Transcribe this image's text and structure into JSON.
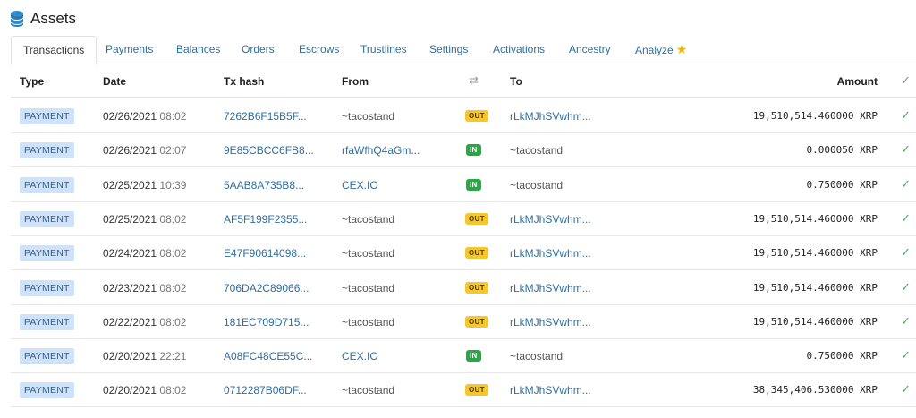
{
  "header": {
    "title": "Assets",
    "logo_icon": "coin-stack-icon"
  },
  "tabs": [
    {
      "label": "Transactions",
      "active": true
    },
    {
      "label": "Payments"
    },
    {
      "label": "Balances"
    },
    {
      "label": "Orders"
    },
    {
      "label": "Escrows"
    },
    {
      "label": "Trustlines"
    },
    {
      "label": "Settings"
    },
    {
      "label": "Activations"
    },
    {
      "label": "Ancestry"
    },
    {
      "label": "Analyze",
      "icon": "star-icon"
    }
  ],
  "table": {
    "headers": {
      "type": "Type",
      "date": "Date",
      "hash": "Tx hash",
      "from": "From",
      "swap": "⇄",
      "to": "To",
      "amount": "Amount",
      "check": "✓"
    },
    "rows": [
      {
        "type": "PAYMENT",
        "date": "02/26/2021",
        "time": "08:02",
        "hash": "7262B6F15B5F...",
        "from": "~tacostand",
        "dir": "OUT",
        "to": "rLkMJhSVwhm...",
        "amount": "19,510,514.460000 XRP"
      },
      {
        "type": "PAYMENT",
        "date": "02/26/2021",
        "time": "02:07",
        "hash": "9E85CBCC6FB8...",
        "from": "rfaWfhQ4aGm...",
        "dir": "IN",
        "to": "~tacostand",
        "amount": "0.000050 XRP"
      },
      {
        "type": "PAYMENT",
        "date": "02/25/2021",
        "time": "10:39",
        "hash": "5AAB8A735B8...",
        "from": "CEX.IO",
        "dir": "IN",
        "to": "~tacostand",
        "amount": "0.750000 XRP"
      },
      {
        "type": "PAYMENT",
        "date": "02/25/2021",
        "time": "08:02",
        "hash": "AF5F199F2355...",
        "from": "~tacostand",
        "dir": "OUT",
        "to": "rLkMJhSVwhm...",
        "amount": "19,510,514.460000 XRP"
      },
      {
        "type": "PAYMENT",
        "date": "02/24/2021",
        "time": "08:02",
        "hash": "E47F90614098...",
        "from": "~tacostand",
        "dir": "OUT",
        "to": "rLkMJhSVwhm...",
        "amount": "19,510,514.460000 XRP"
      },
      {
        "type": "PAYMENT",
        "date": "02/23/2021",
        "time": "08:02",
        "hash": "706DA2C89066...",
        "from": "~tacostand",
        "dir": "OUT",
        "to": "rLkMJhSVwhm...",
        "amount": "19,510,514.460000 XRP"
      },
      {
        "type": "PAYMENT",
        "date": "02/22/2021",
        "time": "08:02",
        "hash": "181EC709D715...",
        "from": "~tacostand",
        "dir": "OUT",
        "to": "rLkMJhSVwhm...",
        "amount": "19,510,514.460000 XRP"
      },
      {
        "type": "PAYMENT",
        "date": "02/20/2021",
        "time": "22:21",
        "hash": "A08FC48CE55C...",
        "from": "CEX.IO",
        "dir": "IN",
        "to": "~tacostand",
        "amount": "0.750000 XRP"
      },
      {
        "type": "PAYMENT",
        "date": "02/20/2021",
        "time": "08:02",
        "hash": "0712287B06DF...",
        "from": "~tacostand",
        "dir": "OUT",
        "to": "rLkMJhSVwhm...",
        "amount": "38,345,406.530000 XRP"
      }
    ],
    "check_mark": "✓"
  },
  "colors": {
    "link": "#2f6e9f",
    "out_badge": "#f5c72c",
    "in_badge": "#28a745",
    "type_badge": "#cfe2f7",
    "success": "#3cb055",
    "star": "#f4b400"
  }
}
